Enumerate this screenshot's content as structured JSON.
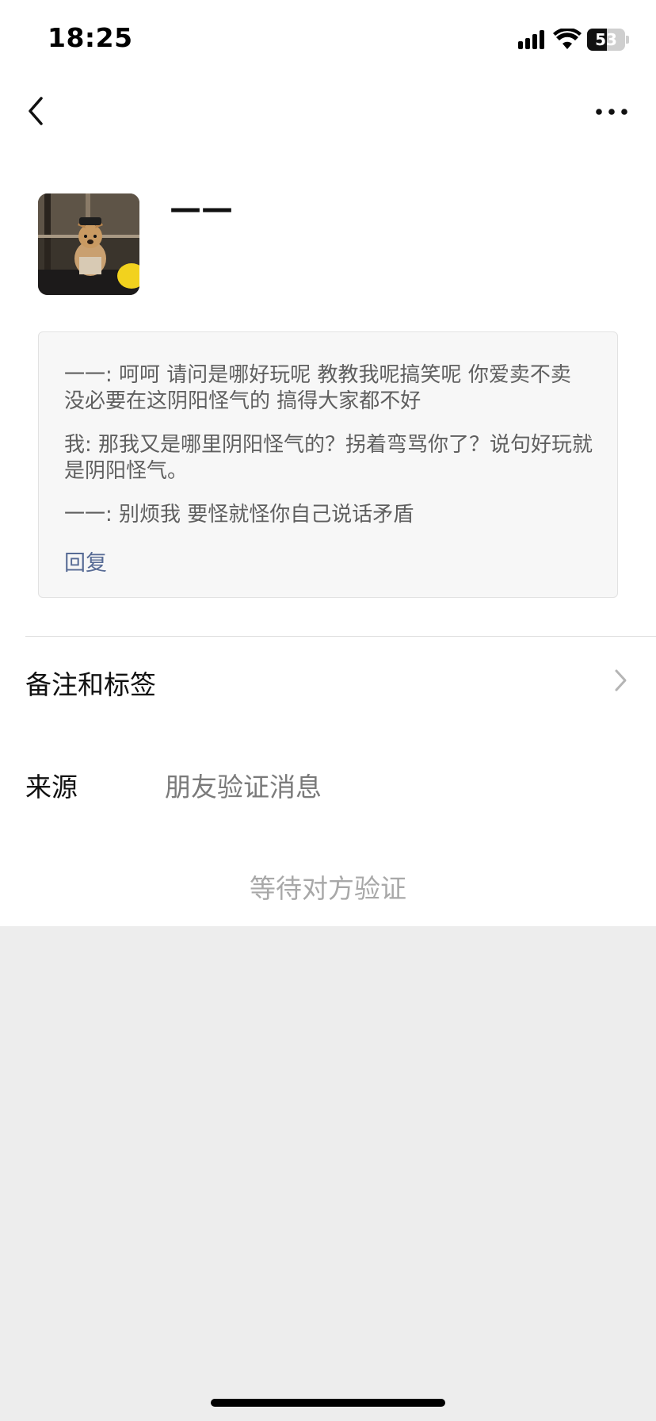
{
  "status_bar": {
    "time": "18:25",
    "battery": {
      "label": "53",
      "level": 0.53
    },
    "icons": [
      "cellular-signal-icon",
      "wifi-icon",
      "battery-icon"
    ]
  },
  "nav": {
    "back_icon": "chevron-left-icon",
    "more_icon": "more-dots-icon"
  },
  "profile": {
    "name": "——",
    "avatar_icon": "dog-photo-avatar"
  },
  "verification_messages": [
    {
      "text": "一一: 呵呵 请问是哪好玩呢 教教我呢搞笑呢 你爱卖不卖  没必要在这阴阳怪气的 搞得大家都不好"
    },
    {
      "text": "我: 那我又是哪里阴阳怪气的？拐着弯骂你了？说句好玩就是阴阳怪气。"
    },
    {
      "text": "一一: 别烦我  要怪就怪你自己说话矛盾"
    }
  ],
  "reply_label": "回复",
  "remark_row": {
    "label": "备注和标签",
    "chevron_icon": "chevron-right-icon"
  },
  "source_row": {
    "label": "来源",
    "value": "朋友验证消息"
  },
  "status_row": {
    "text": "等待对方验证"
  },
  "colors": {
    "link": "#576b95",
    "background": "#ededed",
    "card": "#ffffff",
    "message_box": "#f7f7f7"
  }
}
